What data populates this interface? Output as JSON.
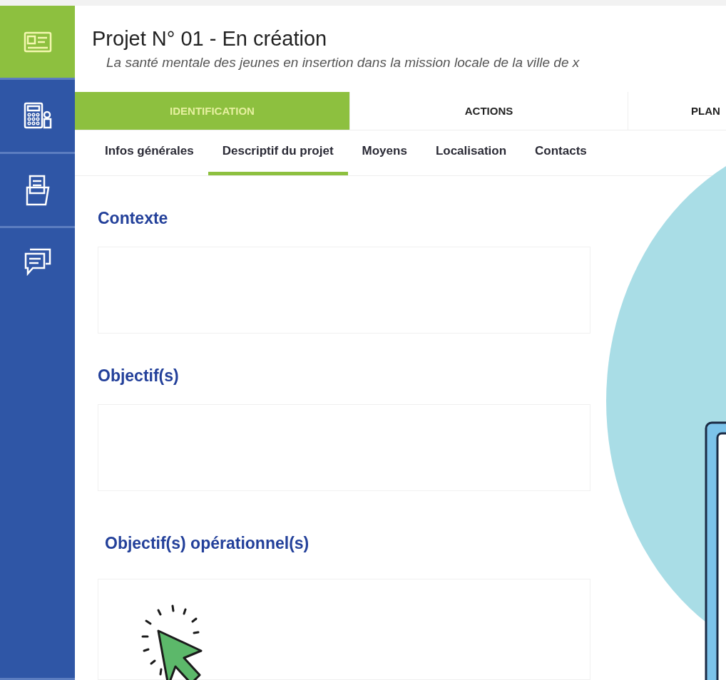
{
  "sidebar": {
    "items": [
      {
        "kind": "card",
        "selected": true
      },
      {
        "kind": "calculator",
        "selected": false
      },
      {
        "kind": "folder",
        "selected": false
      },
      {
        "kind": "chat",
        "selected": false
      }
    ]
  },
  "header": {
    "title": "Projet N° 01 - En création",
    "subtitle": "La santé mentale des jeunes en insertion dans la mission locale de la ville de x"
  },
  "tabs": [
    {
      "label": "IDENTIFICATION",
      "selected": true
    },
    {
      "label": "ACTIONS",
      "selected": false
    },
    {
      "label": "PLAN",
      "selected": false
    }
  ],
  "subtabs": [
    {
      "label": "Infos générales",
      "selected": false
    },
    {
      "label": "Descriptif du projet",
      "selected": true
    },
    {
      "label": "Moyens",
      "selected": false
    },
    {
      "label": "Localisation",
      "selected": false
    },
    {
      "label": "Contacts",
      "selected": false
    }
  ],
  "sections": [
    {
      "title": "Contexte"
    },
    {
      "title": "Objectif(s)"
    },
    {
      "title": "Objectif(s) opérationnel(s)"
    }
  ]
}
